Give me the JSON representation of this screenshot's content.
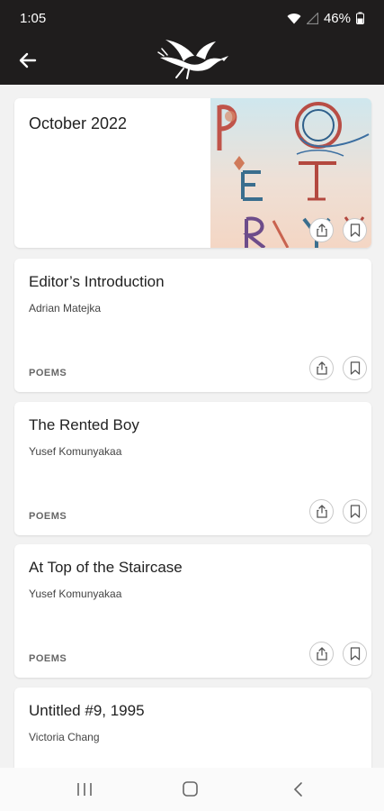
{
  "status_bar": {
    "time": "1:05",
    "battery": "46%",
    "icons": [
      "wifi-icon",
      "signal-icon",
      "battery-icon"
    ]
  },
  "app_bar": {
    "back_icon": "arrow-left-icon",
    "logo": "bird-logo"
  },
  "issue": {
    "title": "October 2022",
    "cover_icon": "issue-cover-art",
    "actions": [
      "share-icon",
      "bookmark-icon"
    ]
  },
  "articles": [
    {
      "title": "Editor’s Introduction",
      "author": "Adrian Matejka",
      "category": "POEMS"
    },
    {
      "title": "The Rented Boy",
      "author": "Yusef Komunyakaa",
      "category": "POEMS"
    },
    {
      "title": "At Top of the Staircase",
      "author": "Yusef Komunyakaa",
      "category": "POEMS"
    },
    {
      "title": "Untitled #9, 1995",
      "author": "Victoria Chang",
      "category": ""
    }
  ],
  "nav_bar": {
    "buttons": [
      "recent-apps-icon",
      "home-icon",
      "back-icon"
    ]
  },
  "colors": {
    "header_bg": "#1f1d1d",
    "page_bg": "#f2f2f2",
    "card_bg": "#ffffff",
    "category_text": "#666666"
  }
}
